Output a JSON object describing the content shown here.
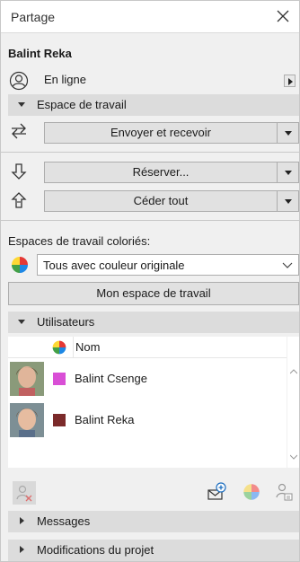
{
  "window": {
    "title": "Partage"
  },
  "user": {
    "name": "Balint Reka",
    "status": "En ligne"
  },
  "workspace": {
    "header": "Espace de travail",
    "send_receive": "Envoyer et recevoir",
    "reserve": "Réserver...",
    "release_all": "Céder tout"
  },
  "colored": {
    "label": "Espaces de travail coloriés:",
    "selected": "Tous avec couleur originale",
    "my_workspace_button": "Mon espace de travail"
  },
  "users": {
    "header": "Utilisateurs",
    "column_name": "Nom",
    "rows": [
      {
        "name": "Balint Csenge",
        "color": "#d94fd6"
      },
      {
        "name": "Balint Reka",
        "color": "#7b2a2a"
      }
    ]
  },
  "sections": {
    "messages": "Messages",
    "project_changes": "Modifications du projet"
  },
  "icons": {
    "close": "close-icon",
    "status": "user-status-icon",
    "send_receive": "send-receive-icon",
    "reserve": "reserve-arrow-icon",
    "release": "release-arrow-icon",
    "color_wheel": "color-wheel-icon",
    "remove_user": "remove-user-icon",
    "message": "message-add-icon",
    "user_color": "user-color-icon",
    "user_settings": "user-settings-icon"
  }
}
